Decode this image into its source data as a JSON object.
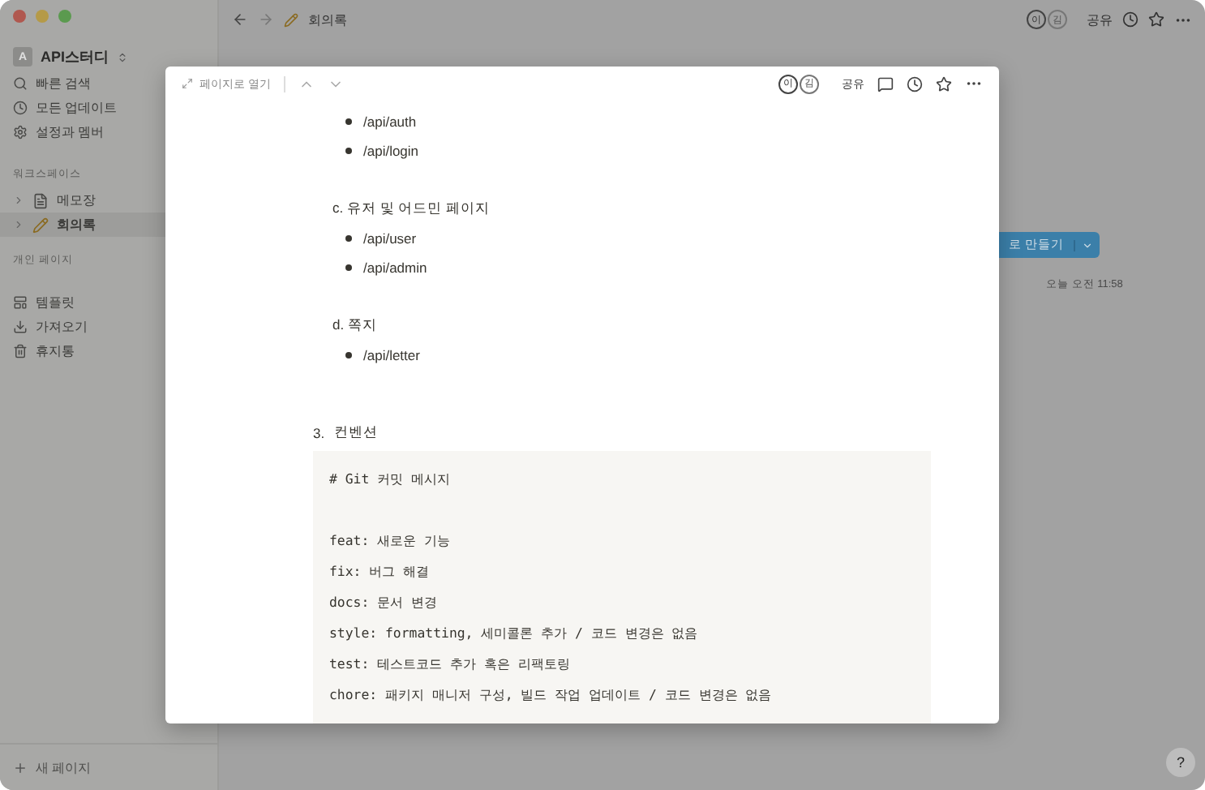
{
  "topbar": {
    "title": "회의록",
    "avatars": [
      "이",
      "김"
    ],
    "share": "공유"
  },
  "sidebar": {
    "workspace": "API스터디",
    "workspace_initial": "A",
    "nav": [
      {
        "label": "빠른 검색",
        "kind": "search"
      },
      {
        "label": "모든 업데이트",
        "kind": "clock"
      },
      {
        "label": "설정과 멤버",
        "kind": "gear"
      }
    ],
    "workspace_section": "워크스페이스",
    "pages": [
      {
        "label": "메모장",
        "kind": "doc",
        "selected": false
      },
      {
        "label": "회의록",
        "kind": "pencil",
        "selected": true
      }
    ],
    "private_section": "개인 페이지",
    "tools": [
      {
        "label": "템플릿",
        "kind": "template"
      },
      {
        "label": "가져오기",
        "kind": "import"
      },
      {
        "label": "휴지통",
        "kind": "trash"
      }
    ],
    "new_page": "새 페이지"
  },
  "background": {
    "button": "로 만들기",
    "time": "오늘 오전 11:58"
  },
  "modal": {
    "open_label": "페이지로 열기",
    "avatars": [
      "이",
      "김"
    ],
    "share": "공유",
    "blocks": [
      {
        "kind": "bullet",
        "text": "/api/auth"
      },
      {
        "kind": "bullet",
        "text": "/api/login"
      },
      {
        "kind": "heading",
        "text": "c. 유저 및 어드민 페이지"
      },
      {
        "kind": "bullet",
        "text": "/api/user"
      },
      {
        "kind": "bullet",
        "text": "/api/admin"
      },
      {
        "kind": "heading",
        "text": "d. 쪽지"
      },
      {
        "kind": "bullet",
        "text": "/api/letter"
      },
      {
        "kind": "numbered",
        "number": "3.",
        "text": "컨벤션"
      },
      {
        "kind": "code",
        "title": "# Git 커밋 메시지",
        "lines": [
          "feat: 새로운 기능",
          "fix: 버그 해결",
          "docs: 문서 변경",
          "style: formatting, 세미콜론 추가 / 코드 변경은 없음",
          "test: 테스트코드 추가 혹은 리팩토링",
          "chore: 패키지 매니저 구성, 빌드 작업 업데이트 / 코드 변경은 없음"
        ]
      }
    ]
  },
  "help": "?"
}
